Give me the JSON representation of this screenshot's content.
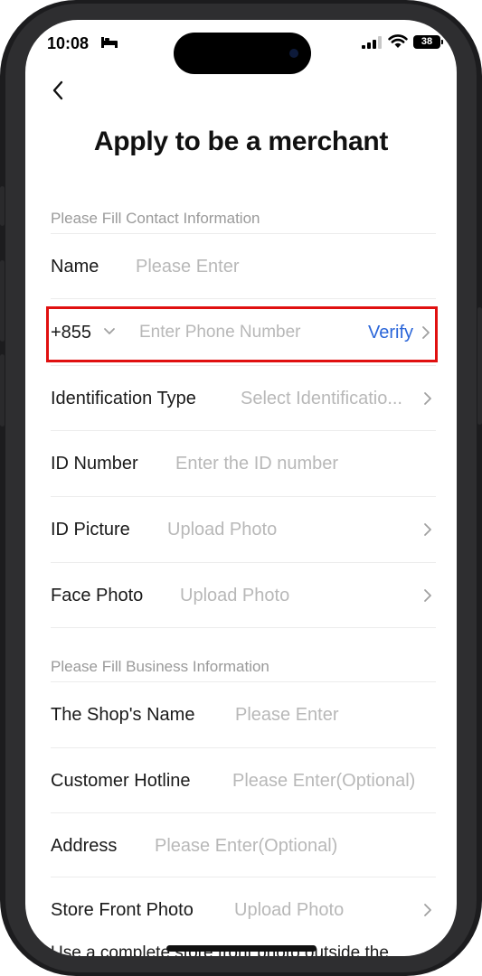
{
  "status_bar": {
    "time": "10:08",
    "battery": "38"
  },
  "header": {
    "title": "Apply to be a merchant"
  },
  "sections": {
    "contact": "Please Fill Contact Information",
    "business": "Please Fill Business Information"
  },
  "fields": {
    "name": {
      "label": "Name",
      "placeholder": "Please Enter"
    },
    "phone": {
      "country_code": "+855",
      "placeholder": "Enter Phone Number",
      "verify": "Verify"
    },
    "id_type": {
      "label": "Identification Type",
      "placeholder": "Select Identificatio..."
    },
    "id_number": {
      "label": "ID Number",
      "placeholder": "Enter the ID number"
    },
    "id_picture": {
      "label": "ID Picture",
      "placeholder": "Upload Photo"
    },
    "face_photo": {
      "label": "Face Photo",
      "placeholder": "Upload Photo"
    },
    "shop_name": {
      "label": "The Shop's Name",
      "placeholder": "Please Enter"
    },
    "hotline": {
      "label": "Customer Hotline",
      "placeholder": "Please Enter(Optional)"
    },
    "address": {
      "label": "Address",
      "placeholder": "Please Enter(Optional)"
    },
    "store_front": {
      "label": "Store Front Photo",
      "placeholder": "Upload Photo"
    }
  },
  "footer_text": "Use a complete store front photo outside the",
  "icons": [
    "back-arrow-icon",
    "chevron-right-icon",
    "chevron-down-icon",
    "signal-icon",
    "wifi-icon",
    "battery-icon",
    "bed-icon"
  ],
  "colors": {
    "accent": "#2b66d9",
    "highlight": "#e01010",
    "placeholder": "#b8b8b8"
  }
}
